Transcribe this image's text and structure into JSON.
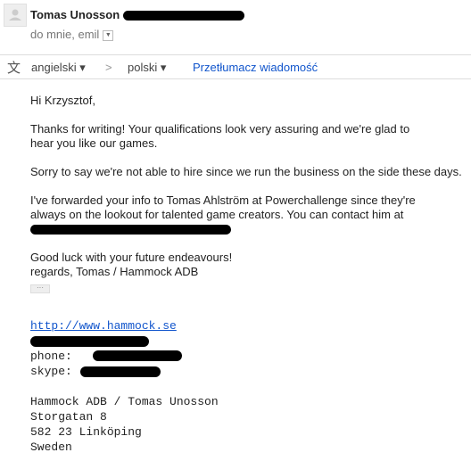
{
  "header": {
    "sender": "Tomas Unosson",
    "recipients": "do mnie, emil",
    "dropdown_icon": "chevron-down-icon"
  },
  "translate": {
    "icon": "translate-icon",
    "from": "angielski",
    "to": "polski",
    "arrow": ">",
    "action": "Przetłumacz wiadomość"
  },
  "message": {
    "greeting": "Hi Krzysztof,",
    "p1": "Thanks for writing! Your qualifications look very assuring and we're glad to hear you like our games.",
    "p2": "Sorry to say we're not able to hire since we run the business on the side these days.",
    "p3": "I've forwarded your info to Tomas Ahlström at Powerchallenge since they're always on the lookout for talented game creators. You can contact him at",
    "p4a": "Good luck with your future endeavours!",
    "p4b": "regards, Tomas / Hammock ADB",
    "ellipsis": "···"
  },
  "signature": {
    "url": "http://www.hammock.se",
    "phone_label": "phone:",
    "skype_label": "skype:",
    "company": "Hammock ADB / Tomas Unosson",
    "street": "Storgatan 8",
    "city": "582 23 Linköping",
    "country": "Sweden"
  }
}
